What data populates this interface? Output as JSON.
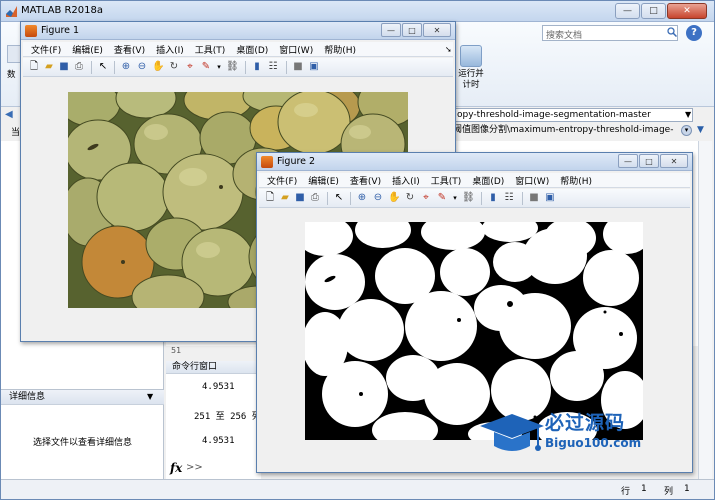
{
  "main_window": {
    "title": "MATLAB R2018a",
    "min": "—",
    "max": "□",
    "close": "✕"
  },
  "toolstrip": {
    "search_placeholder": "搜索文档",
    "help": "?",
    "run_label_1": "运行并",
    "run_label_2": "计时",
    "left_fragment": "数"
  },
  "address": {
    "current_folder": "opy-threshold-image-segmentation-master",
    "dropdown": "▼",
    "path": "阈值图像分割\\maximum-entropy-threshold-image-",
    "nav_back": "◀"
  },
  "left_panel": {
    "char": "当",
    "details_title": "详细信息",
    "details_caret": "▼",
    "details_text": "选择文件以查看详细信息"
  },
  "editor": {
    "line_number": "51"
  },
  "command_window": {
    "title": "命令行窗口",
    "lines": [
      "4.9531",
      "251 至 256 列",
      "4.9531"
    ],
    "fx": "fx",
    "prompt": ">>"
  },
  "statusbar": {
    "row_label": "行",
    "row_value": "1",
    "col_label": "列",
    "col_value": "1"
  },
  "figure1": {
    "title": "Figure 1",
    "menus": [
      "文件(F)",
      "编辑(E)",
      "查看(V)",
      "插入(I)",
      "工具(T)",
      "桌面(D)",
      "窗口(W)",
      "帮助(H)"
    ],
    "min": "—",
    "max": "□",
    "close": "✕"
  },
  "figure2": {
    "title": "Figure 2",
    "menus": [
      "文件(F)",
      "编辑(E)",
      "查看(V)",
      "插入(I)",
      "工具(T)",
      "桌面(D)",
      "窗口(W)",
      "帮助(H)"
    ],
    "min": "—",
    "max": "□",
    "close": "✕"
  },
  "watermark": {
    "text": "必过源码",
    "url": "Biguo100.com"
  },
  "colors": {
    "title_blue": "#c4d6ee",
    "watermark_blue": "#1e63b8",
    "fruit_green": "#b6ba7a",
    "fruit_orange": "#c98a3a"
  }
}
